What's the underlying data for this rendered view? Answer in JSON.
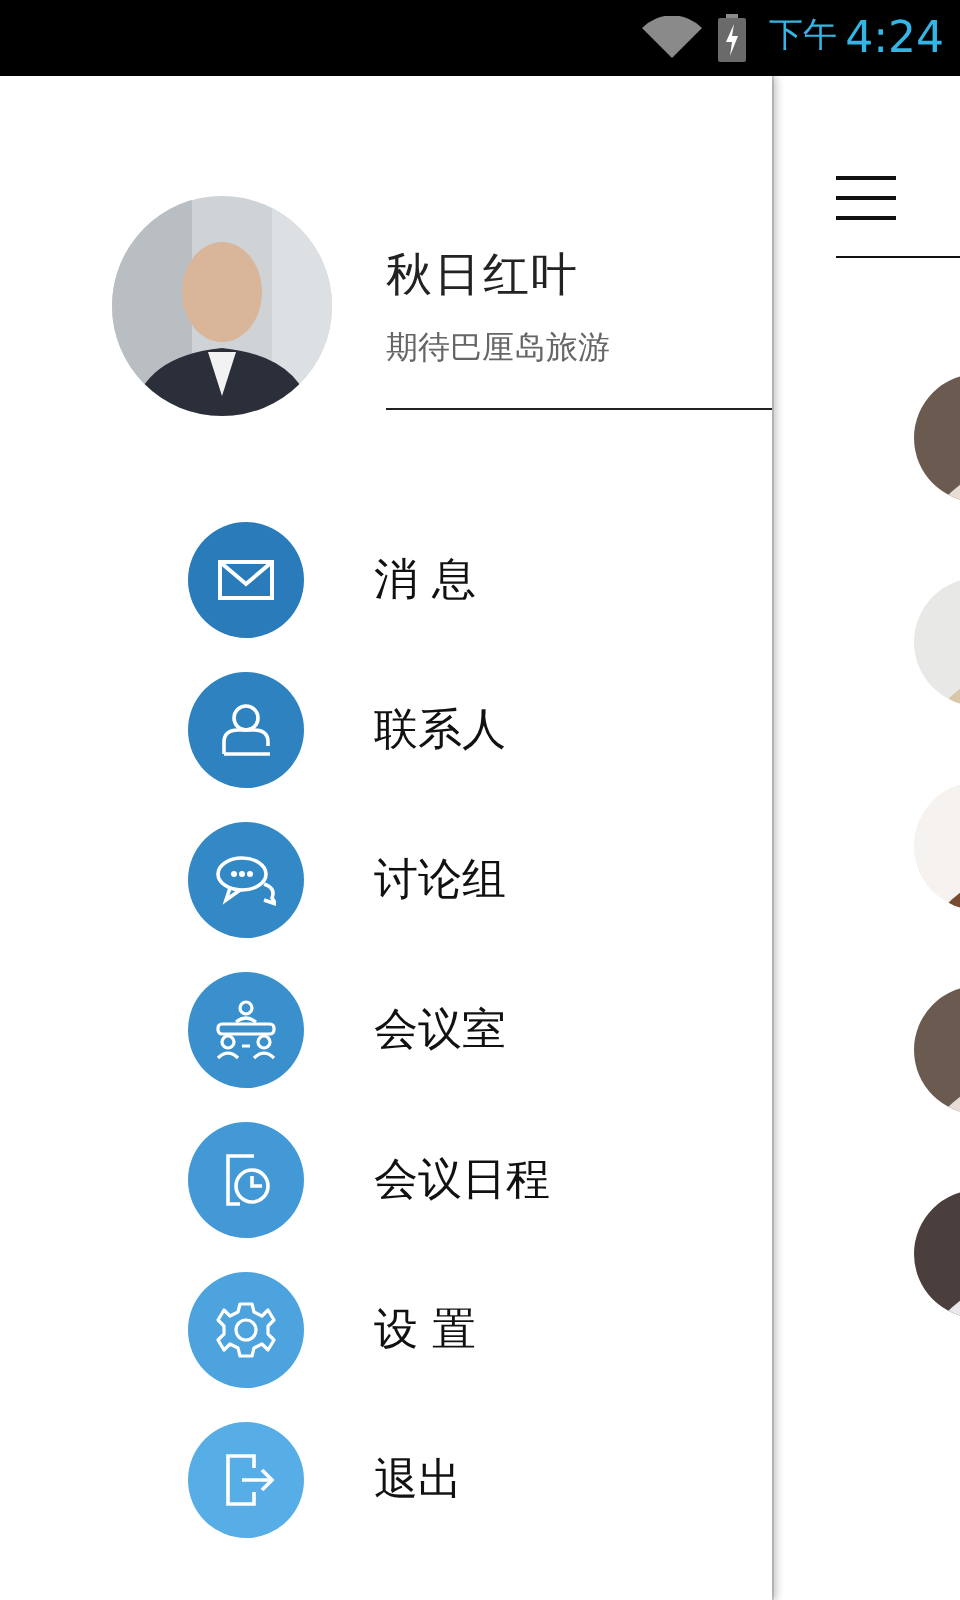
{
  "status_bar": {
    "period": "下午",
    "time": "4:24"
  },
  "profile": {
    "name": "秋日红叶",
    "motto": "期待巴厘岛旅游"
  },
  "menu": [
    {
      "label": "消 息",
      "kind": "mail",
      "color": "#2a7bb9"
    },
    {
      "label": "联系人",
      "kind": "person",
      "color": "#2e82bf"
    },
    {
      "label": "讨论组",
      "kind": "chat",
      "color": "#3388c6"
    },
    {
      "label": "会议室",
      "kind": "meeting",
      "color": "#3a90cd"
    },
    {
      "label": "会议日程",
      "kind": "schedule",
      "color": "#4399d5"
    },
    {
      "label": "设 置",
      "kind": "settings",
      "color": "#4ca3dd"
    },
    {
      "label": "退出",
      "kind": "logout",
      "color": "#57ade5"
    }
  ]
}
